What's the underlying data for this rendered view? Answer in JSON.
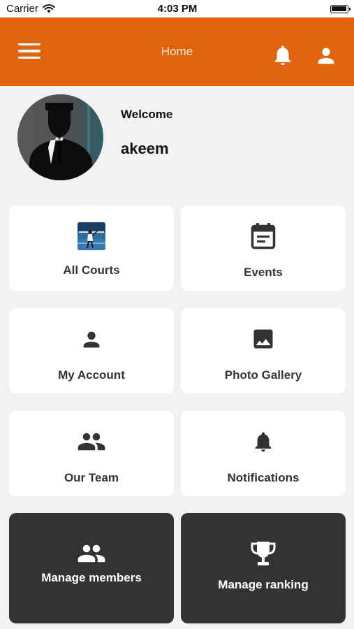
{
  "status_bar": {
    "carrier": "Carrier",
    "time": "4:03 PM"
  },
  "header": {
    "title": "Home",
    "color": "#e0640f"
  },
  "profile": {
    "welcome": "Welcome",
    "name": "akeem"
  },
  "tiles": [
    {
      "label": "All Courts",
      "icon": "court-photo-icon"
    },
    {
      "label": "Events",
      "icon": "calendar-icon"
    },
    {
      "label": "My Account",
      "icon": "person-icon"
    },
    {
      "label": "Photo Gallery",
      "icon": "image-icon"
    },
    {
      "label": "Our Team",
      "icon": "group-icon"
    },
    {
      "label": "Notifications",
      "icon": "bell-icon"
    },
    {
      "label": "Manage members",
      "icon": "group-icon"
    },
    {
      "label": "Manage ranking",
      "icon": "trophy-icon"
    }
  ]
}
